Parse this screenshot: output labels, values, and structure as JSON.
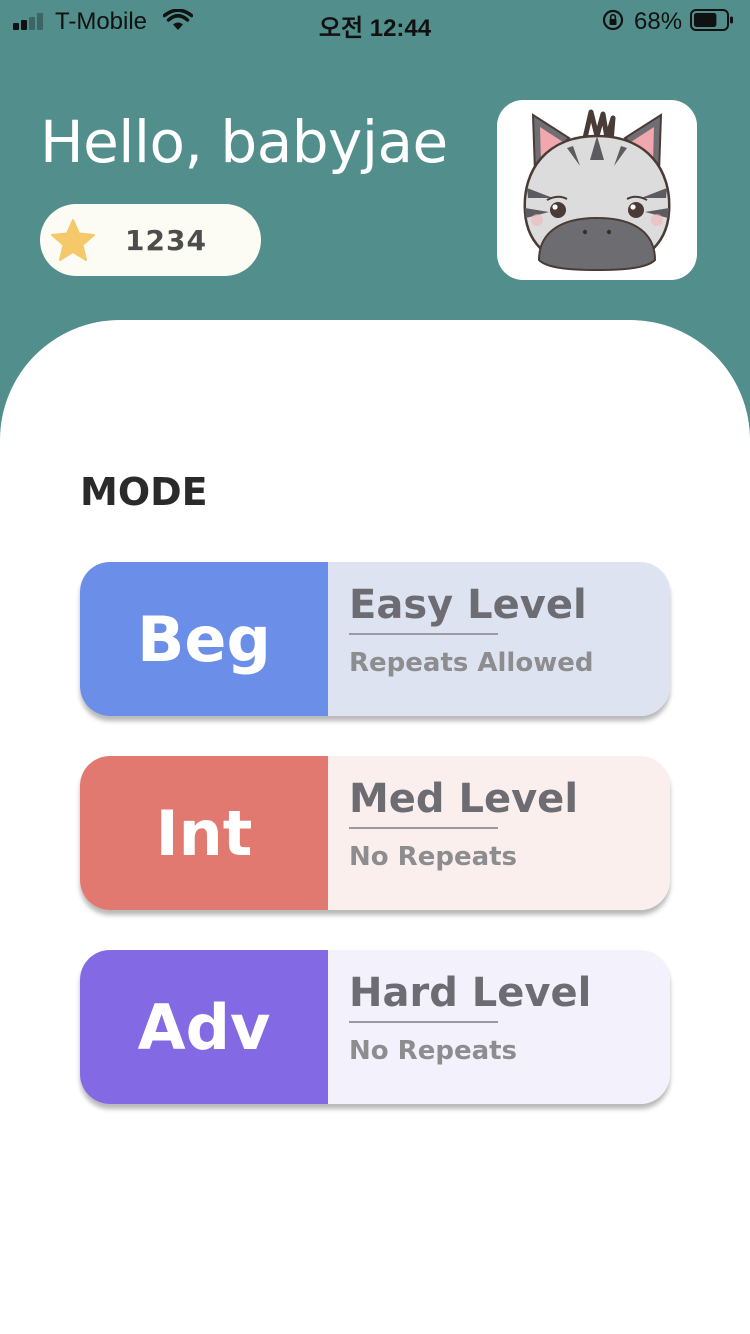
{
  "status_bar": {
    "carrier": "T-Mobile",
    "time": "오전 12:44",
    "battery_percent": "68%",
    "battery_level": 0.68,
    "signal_bars_active": 2,
    "icons": [
      "signal-icon",
      "wifi-icon",
      "rotation-lock-icon",
      "battery-icon"
    ]
  },
  "header": {
    "greeting": "Hello, babyjae",
    "score": "1234",
    "score_icon": "star-icon",
    "avatar_icon": "zebra-avatar-icon"
  },
  "mode": {
    "title": "MODE",
    "cards": [
      {
        "badge": "Beg",
        "title": "Easy Level",
        "subtitle": "Repeats Allowed",
        "badge_color": "#6b8ee9",
        "body_color": "#dde3f1"
      },
      {
        "badge": "Int",
        "title": "Med Level",
        "subtitle": "No Repeats",
        "badge_color": "#e27970",
        "body_color": "#fbefee"
      },
      {
        "badge": "Adv",
        "title": "Hard Level",
        "subtitle": "No Repeats",
        "badge_color": "#8369e3",
        "body_color": "#f3f1fc"
      }
    ]
  },
  "colors": {
    "header_bg": "#528f8c",
    "star": "#f5c96a",
    "text_dark": "#2a2a2a"
  }
}
